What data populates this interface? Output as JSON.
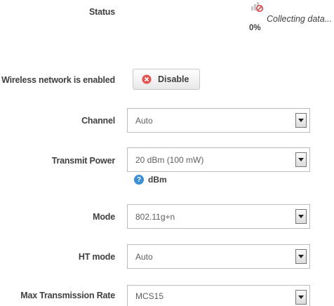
{
  "status": {
    "label": "Status",
    "percent": "0%",
    "text": "Collecting data..."
  },
  "wireless": {
    "label": "Wireless network is enabled",
    "button_label": "Disable"
  },
  "channel": {
    "label": "Channel",
    "value": "Auto"
  },
  "transmit_power": {
    "label": "Transmit Power",
    "value": "20 dBm (100 mW)",
    "help_text": "dBm"
  },
  "mode": {
    "label": "Mode",
    "value": "802.11g+n"
  },
  "ht_mode": {
    "label": "HT mode",
    "value": "Auto"
  },
  "max_rate": {
    "label": "Max Transmission Rate",
    "value": "MCS15"
  },
  "colors": {
    "disable_icon": "#e8504f",
    "help_icon": "#3a8fd6"
  },
  "icons": {
    "status": "signal-blocked-icon",
    "disable": "x-circle-icon",
    "help": "question-icon"
  }
}
